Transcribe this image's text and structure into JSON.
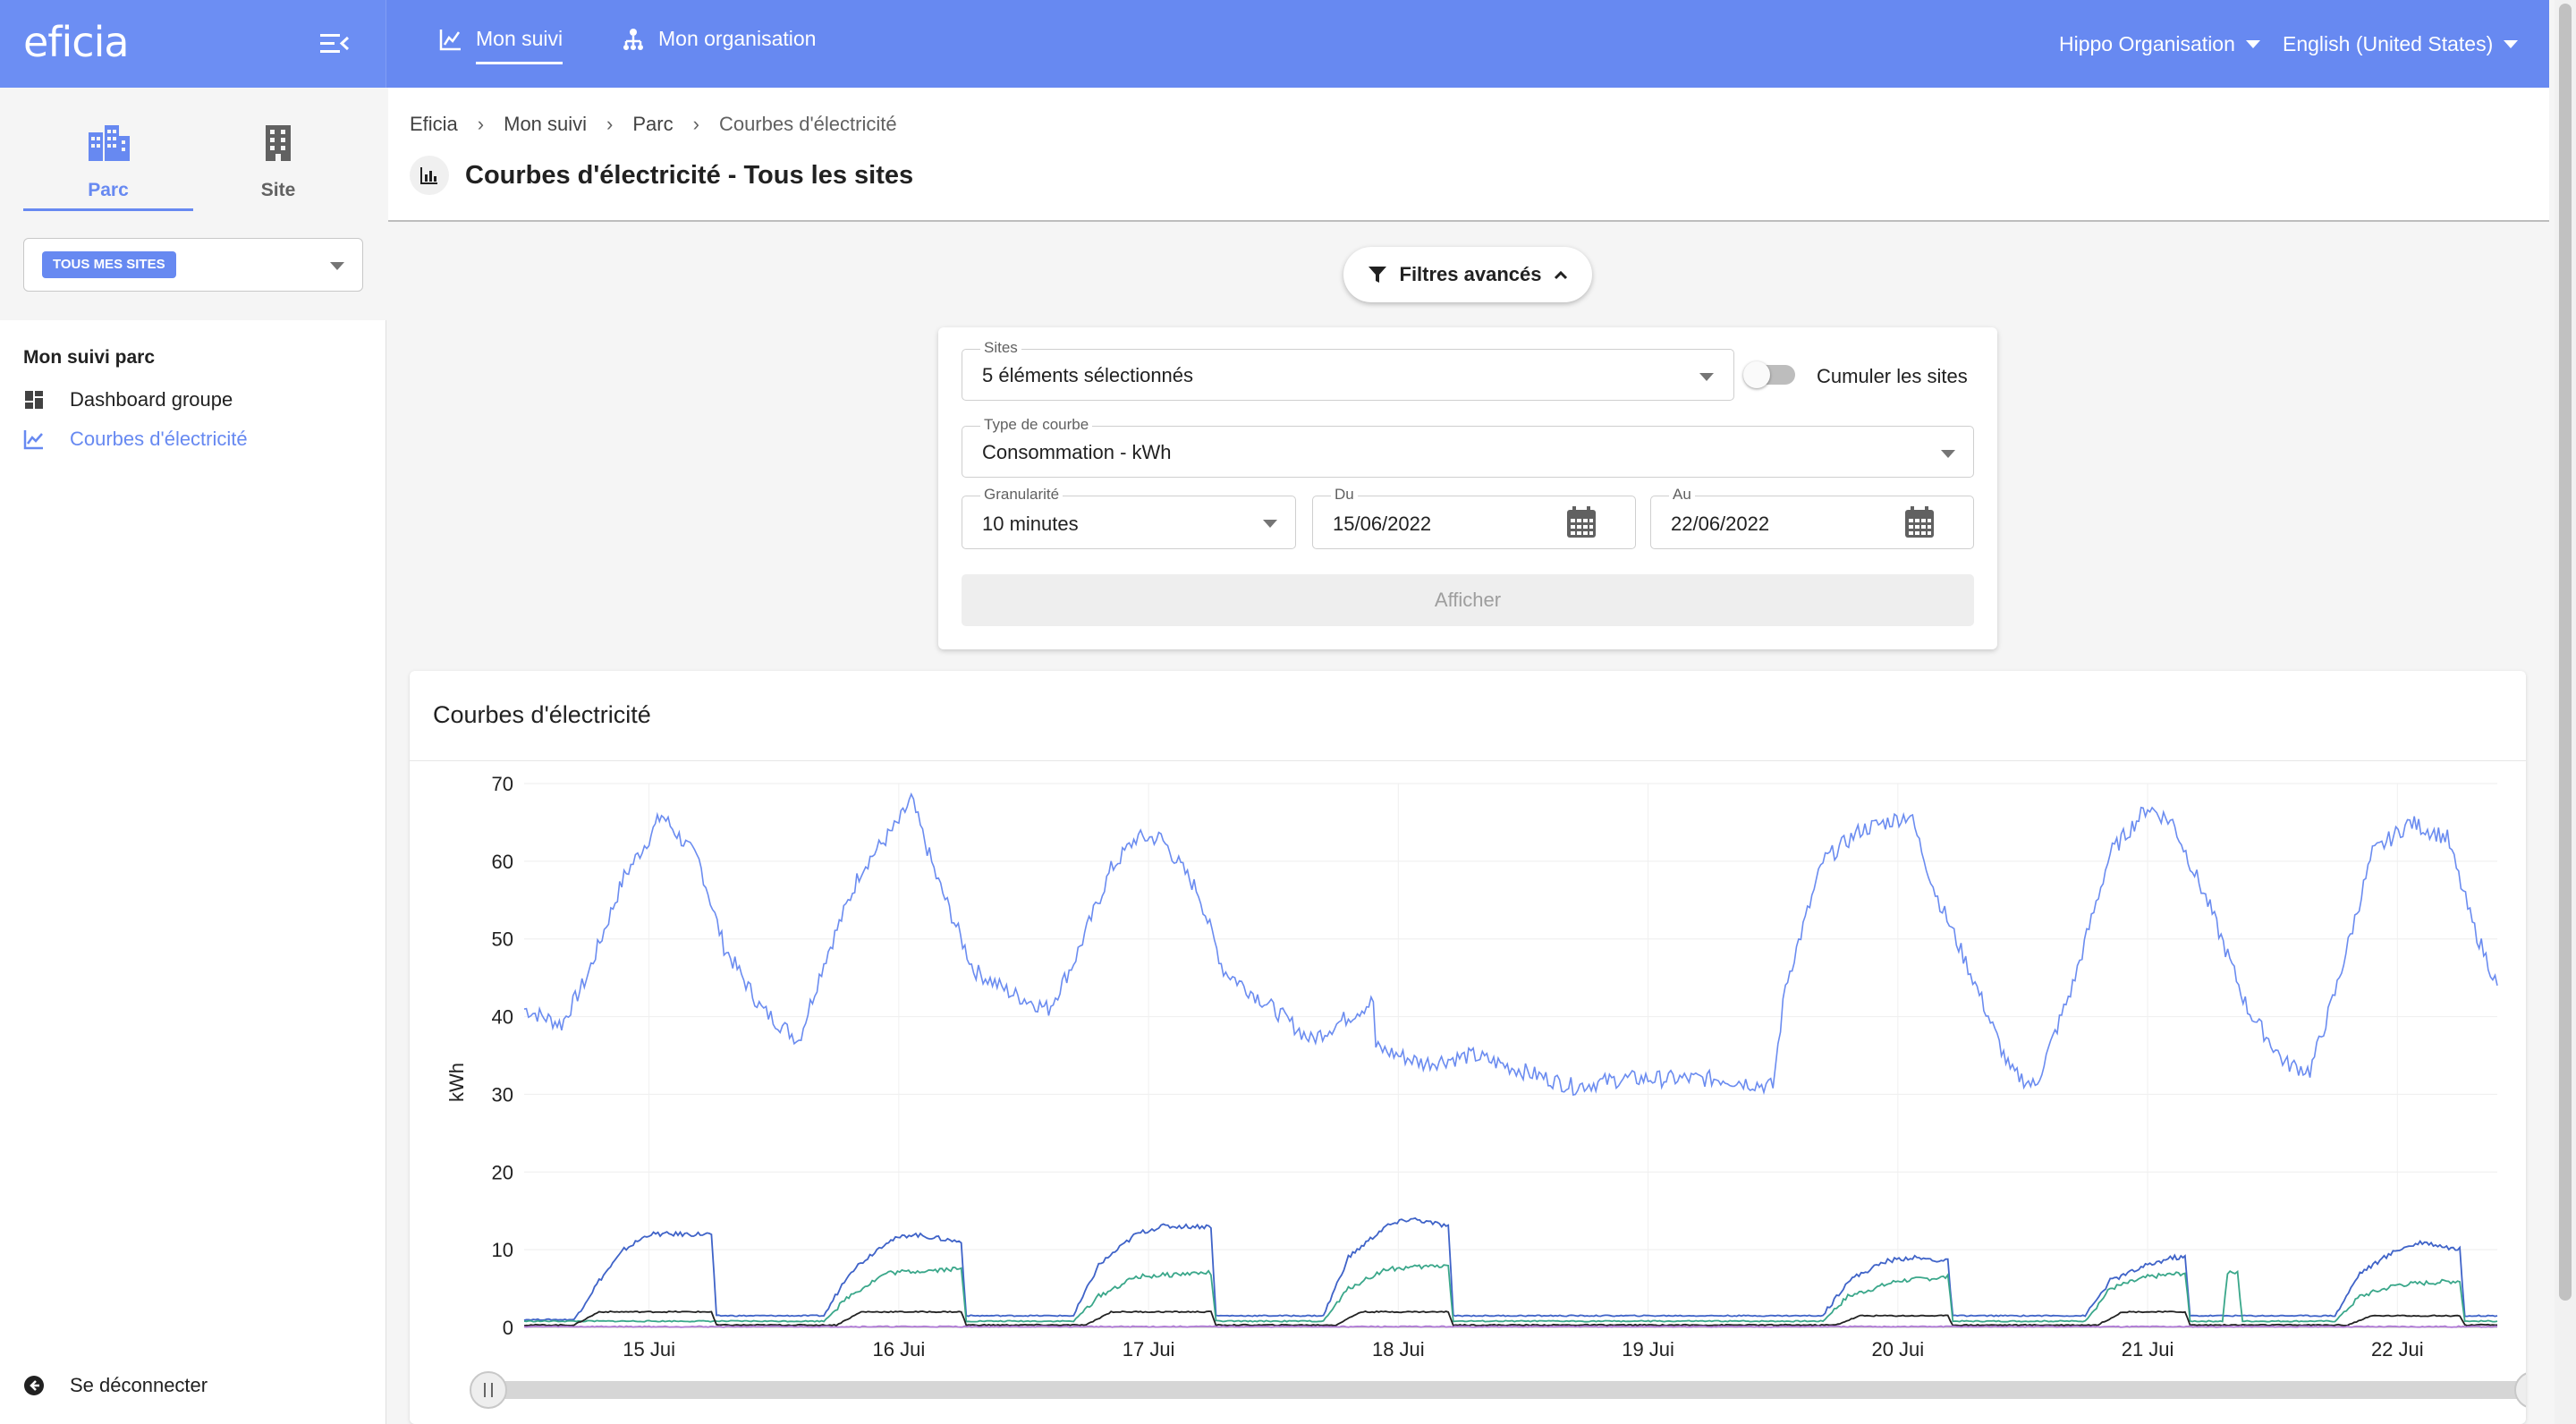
{
  "app": {
    "logo": "eficia",
    "nav": [
      {
        "label": "Mon suivi",
        "icon": "chart-icon",
        "active": true
      },
      {
        "label": "Mon organisation",
        "icon": "org-icon",
        "active": false
      }
    ],
    "organisation": "Hippo Organisation",
    "language": "English (United States)"
  },
  "sidebar": {
    "tabs": [
      {
        "label": "Parc",
        "icon": "buildings-icon",
        "active": true
      },
      {
        "label": "Site",
        "icon": "building-icon",
        "active": false
      }
    ],
    "site_chip": "TOUS MES SITES",
    "section_heading": "Mon suivi parc",
    "links": [
      {
        "label": "Dashboard groupe",
        "icon": "dashboard-icon",
        "active": false
      },
      {
        "label": "Courbes d'électricité",
        "icon": "line-chart-icon",
        "active": true
      }
    ],
    "logout": "Se déconnecter"
  },
  "header": {
    "breadcrumb": [
      "Eficia",
      "Mon suivi",
      "Parc",
      "Courbes d'électricité"
    ],
    "title": "Courbes d'électricité - Tous les sites"
  },
  "filters": {
    "toggle_label": "Filtres avancés",
    "sites": {
      "label": "Sites",
      "value": "5 éléments sélectionnés"
    },
    "cumulate_label": "Cumuler les sites",
    "curve_type": {
      "label": "Type de courbe",
      "value": "Consommation - kWh"
    },
    "granularity": {
      "label": "Granularité",
      "value": "10 minutes"
    },
    "from": {
      "label": "Du",
      "value": "15/06/2022"
    },
    "to": {
      "label": "Au",
      "value": "22/06/2022"
    },
    "submit": "Afficher"
  },
  "chart_card": {
    "title": "Courbes d'électricité"
  },
  "chart_data": {
    "type": "line",
    "ylabel": "kWh",
    "ylim": [
      0,
      70
    ],
    "yticks": [
      0,
      10,
      20,
      30,
      40,
      50,
      60,
      70
    ],
    "xlim": [
      -0.5,
      7.4
    ],
    "x_tick_positions": [
      0,
      1,
      2,
      3,
      4,
      5,
      6,
      7
    ],
    "x_tick_labels": [
      "15 Jui",
      "16 Jui",
      "17 Jui",
      "18 Jui",
      "19 Jui",
      "20 Jui",
      "21 Jui",
      "22 Jui"
    ],
    "grid": true,
    "series_profiles": [
      {
        "color": "#6b8cf0",
        "points": [
          [
            -0.5,
            41
          ],
          [
            -0.35,
            39
          ],
          [
            -0.25,
            45
          ],
          [
            -0.1,
            58
          ],
          [
            0,
            63
          ],
          [
            0.05,
            66
          ],
          [
            0.2,
            60
          ],
          [
            0.3,
            49
          ],
          [
            0.45,
            41
          ],
          [
            0.6,
            37
          ],
          [
            0.7,
            47
          ],
          [
            0.85,
            59
          ],
          [
            1,
            65
          ],
          [
            1.05,
            68
          ],
          [
            1.15,
            58
          ],
          [
            1.3,
            46
          ],
          [
            1.45,
            43
          ],
          [
            1.6,
            41
          ],
          [
            1.7,
            47
          ],
          [
            1.85,
            59
          ],
          [
            1.95,
            63
          ],
          [
            2.05,
            63
          ],
          [
            2.2,
            56
          ],
          [
            2.3,
            46
          ],
          [
            2.5,
            41
          ],
          [
            2.65,
            37
          ],
          [
            2.8,
            40
          ],
          [
            2.9,
            42
          ],
          [
            2.91,
            36
          ],
          [
            3.1,
            34
          ],
          [
            3.3,
            35
          ],
          [
            3.5,
            33
          ],
          [
            3.7,
            31
          ],
          [
            3.9,
            32
          ],
          [
            4.1,
            32
          ],
          [
            4.3,
            32
          ],
          [
            4.5,
            31
          ],
          [
            4.55,
            44
          ],
          [
            4.7,
            60
          ],
          [
            4.85,
            64
          ],
          [
            5.05,
            66
          ],
          [
            5.15,
            56
          ],
          [
            5.3,
            45
          ],
          [
            5.45,
            33
          ],
          [
            5.55,
            31
          ],
          [
            5.7,
            44
          ],
          [
            5.85,
            61
          ],
          [
            6,
            67
          ],
          [
            6.1,
            65
          ],
          [
            6.25,
            54
          ],
          [
            6.4,
            41
          ],
          [
            6.55,
            34
          ],
          [
            6.65,
            33
          ],
          [
            6.75,
            43
          ],
          [
            6.9,
            61
          ],
          [
            7.05,
            65
          ],
          [
            7.2,
            63
          ],
          [
            7.3,
            52
          ],
          [
            7.4,
            44
          ]
        ]
      },
      {
        "color": "#3f63c8",
        "points": [
          [
            -0.5,
            1
          ],
          [
            -0.3,
            1
          ],
          [
            -0.2,
            6
          ],
          [
            -0.1,
            10
          ],
          [
            0,
            12
          ],
          [
            0.25,
            12
          ],
          [
            0.27,
            1.5
          ],
          [
            0.7,
            1.5
          ],
          [
            0.8,
            7
          ],
          [
            0.95,
            11
          ],
          [
            1.05,
            12
          ],
          [
            1.25,
            11
          ],
          [
            1.27,
            1.5
          ],
          [
            1.7,
            1.5
          ],
          [
            1.8,
            8
          ],
          [
            1.95,
            12
          ],
          [
            2.05,
            13
          ],
          [
            2.25,
            13
          ],
          [
            2.27,
            1.5
          ],
          [
            2.7,
            1.5
          ],
          [
            2.8,
            9
          ],
          [
            2.95,
            13
          ],
          [
            3.05,
            14
          ],
          [
            3.2,
            13
          ],
          [
            3.22,
            1.5
          ],
          [
            4.7,
            1.5
          ],
          [
            4.8,
            6
          ],
          [
            4.95,
            8.5
          ],
          [
            5.05,
            9
          ],
          [
            5.2,
            8.5
          ],
          [
            5.22,
            1.5
          ],
          [
            5.75,
            1.5
          ],
          [
            5.85,
            6
          ],
          [
            6,
            8
          ],
          [
            6.1,
            9
          ],
          [
            6.15,
            9
          ],
          [
            6.17,
            1.5
          ],
          [
            6.75,
            1.5
          ],
          [
            6.85,
            7
          ],
          [
            7,
            10
          ],
          [
            7.1,
            11
          ],
          [
            7.25,
            10
          ],
          [
            7.27,
            1.5
          ],
          [
            7.4,
            1.5
          ]
        ]
      },
      {
        "color": "#3aa78a",
        "points": [
          [
            -0.5,
            0.8
          ],
          [
            0.7,
            0.8
          ],
          [
            0.8,
            4
          ],
          [
            0.95,
            7
          ],
          [
            1.2,
            7.5
          ],
          [
            1.25,
            7.5
          ],
          [
            1.27,
            0.8
          ],
          [
            1.7,
            0.8
          ],
          [
            1.8,
            4
          ],
          [
            1.95,
            6.5
          ],
          [
            2.2,
            7
          ],
          [
            2.25,
            7
          ],
          [
            2.27,
            0.8
          ],
          [
            2.7,
            0.8
          ],
          [
            2.8,
            5
          ],
          [
            2.95,
            7.5
          ],
          [
            3.2,
            8
          ],
          [
            3.22,
            0.8
          ],
          [
            4.7,
            0.8
          ],
          [
            4.8,
            4
          ],
          [
            5,
            6
          ],
          [
            5.2,
            6.5
          ],
          [
            5.22,
            0.8
          ],
          [
            5.75,
            0.8
          ],
          [
            5.85,
            5
          ],
          [
            6,
            6.5
          ],
          [
            6.15,
            7
          ],
          [
            6.17,
            0.8
          ],
          [
            6.3,
            0.8
          ],
          [
            6.32,
            7
          ],
          [
            6.36,
            7
          ],
          [
            6.38,
            0.8
          ],
          [
            6.75,
            0.8
          ],
          [
            6.85,
            4
          ],
          [
            7,
            5.5
          ],
          [
            7.25,
            6
          ],
          [
            7.27,
            0.8
          ],
          [
            7.4,
            0.8
          ]
        ]
      },
      {
        "color": "#222222",
        "points": [
          [
            -0.5,
            0.3
          ],
          [
            -0.3,
            0.3
          ],
          [
            -0.2,
            2
          ],
          [
            0.25,
            2
          ],
          [
            0.27,
            0.3
          ],
          [
            0.75,
            0.3
          ],
          [
            0.85,
            2
          ],
          [
            1.25,
            2
          ],
          [
            1.27,
            0.3
          ],
          [
            1.75,
            0.3
          ],
          [
            1.85,
            2
          ],
          [
            2.25,
            2
          ],
          [
            2.27,
            0.3
          ],
          [
            2.75,
            0.3
          ],
          [
            2.85,
            2
          ],
          [
            3.2,
            2
          ],
          [
            3.22,
            0.3
          ],
          [
            4.75,
            0.3
          ],
          [
            4.85,
            1.5
          ],
          [
            5.2,
            1.5
          ],
          [
            5.22,
            0.3
          ],
          [
            5.8,
            0.3
          ],
          [
            5.9,
            2
          ],
          [
            6.15,
            2
          ],
          [
            6.17,
            0.3
          ],
          [
            6.8,
            0.3
          ],
          [
            6.9,
            1.5
          ],
          [
            7.25,
            1.5
          ],
          [
            7.27,
            0.3
          ],
          [
            7.4,
            0.3
          ]
        ]
      },
      {
        "color": "#b07ad6",
        "points": [
          [
            -0.5,
            0.1
          ],
          [
            7.4,
            0.1
          ]
        ]
      }
    ]
  }
}
